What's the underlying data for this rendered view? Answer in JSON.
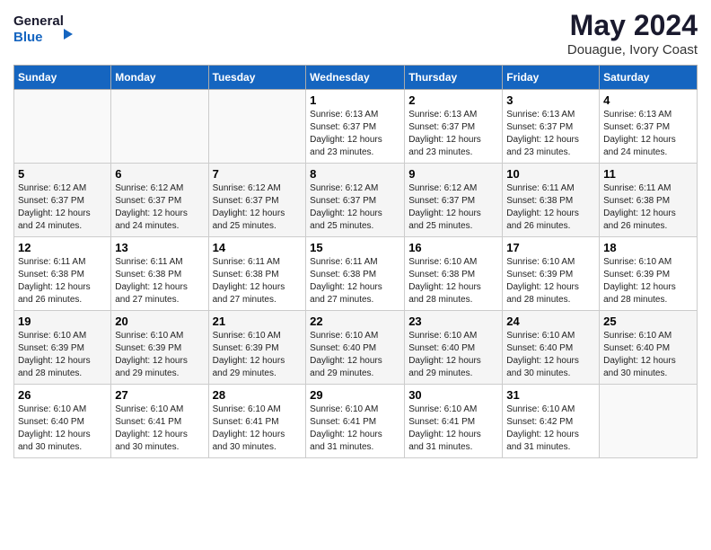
{
  "header": {
    "logo_line1": "General",
    "logo_line2": "Blue",
    "title": "May 2024",
    "subtitle": "Douague, Ivory Coast"
  },
  "weekdays": [
    "Sunday",
    "Monday",
    "Tuesday",
    "Wednesday",
    "Thursday",
    "Friday",
    "Saturday"
  ],
  "weeks": [
    [
      {
        "day": "",
        "info": ""
      },
      {
        "day": "",
        "info": ""
      },
      {
        "day": "",
        "info": ""
      },
      {
        "day": "1",
        "info": "Sunrise: 6:13 AM\nSunset: 6:37 PM\nDaylight: 12 hours\nand 23 minutes."
      },
      {
        "day": "2",
        "info": "Sunrise: 6:13 AM\nSunset: 6:37 PM\nDaylight: 12 hours\nand 23 minutes."
      },
      {
        "day": "3",
        "info": "Sunrise: 6:13 AM\nSunset: 6:37 PM\nDaylight: 12 hours\nand 23 minutes."
      },
      {
        "day": "4",
        "info": "Sunrise: 6:13 AM\nSunset: 6:37 PM\nDaylight: 12 hours\nand 24 minutes."
      }
    ],
    [
      {
        "day": "5",
        "info": "Sunrise: 6:12 AM\nSunset: 6:37 PM\nDaylight: 12 hours\nand 24 minutes."
      },
      {
        "day": "6",
        "info": "Sunrise: 6:12 AM\nSunset: 6:37 PM\nDaylight: 12 hours\nand 24 minutes."
      },
      {
        "day": "7",
        "info": "Sunrise: 6:12 AM\nSunset: 6:37 PM\nDaylight: 12 hours\nand 25 minutes."
      },
      {
        "day": "8",
        "info": "Sunrise: 6:12 AM\nSunset: 6:37 PM\nDaylight: 12 hours\nand 25 minutes."
      },
      {
        "day": "9",
        "info": "Sunrise: 6:12 AM\nSunset: 6:37 PM\nDaylight: 12 hours\nand 25 minutes."
      },
      {
        "day": "10",
        "info": "Sunrise: 6:11 AM\nSunset: 6:38 PM\nDaylight: 12 hours\nand 26 minutes."
      },
      {
        "day": "11",
        "info": "Sunrise: 6:11 AM\nSunset: 6:38 PM\nDaylight: 12 hours\nand 26 minutes."
      }
    ],
    [
      {
        "day": "12",
        "info": "Sunrise: 6:11 AM\nSunset: 6:38 PM\nDaylight: 12 hours\nand 26 minutes."
      },
      {
        "day": "13",
        "info": "Sunrise: 6:11 AM\nSunset: 6:38 PM\nDaylight: 12 hours\nand 27 minutes."
      },
      {
        "day": "14",
        "info": "Sunrise: 6:11 AM\nSunset: 6:38 PM\nDaylight: 12 hours\nand 27 minutes."
      },
      {
        "day": "15",
        "info": "Sunrise: 6:11 AM\nSunset: 6:38 PM\nDaylight: 12 hours\nand 27 minutes."
      },
      {
        "day": "16",
        "info": "Sunrise: 6:10 AM\nSunset: 6:38 PM\nDaylight: 12 hours\nand 28 minutes."
      },
      {
        "day": "17",
        "info": "Sunrise: 6:10 AM\nSunset: 6:39 PM\nDaylight: 12 hours\nand 28 minutes."
      },
      {
        "day": "18",
        "info": "Sunrise: 6:10 AM\nSunset: 6:39 PM\nDaylight: 12 hours\nand 28 minutes."
      }
    ],
    [
      {
        "day": "19",
        "info": "Sunrise: 6:10 AM\nSunset: 6:39 PM\nDaylight: 12 hours\nand 28 minutes."
      },
      {
        "day": "20",
        "info": "Sunrise: 6:10 AM\nSunset: 6:39 PM\nDaylight: 12 hours\nand 29 minutes."
      },
      {
        "day": "21",
        "info": "Sunrise: 6:10 AM\nSunset: 6:39 PM\nDaylight: 12 hours\nand 29 minutes."
      },
      {
        "day": "22",
        "info": "Sunrise: 6:10 AM\nSunset: 6:40 PM\nDaylight: 12 hours\nand 29 minutes."
      },
      {
        "day": "23",
        "info": "Sunrise: 6:10 AM\nSunset: 6:40 PM\nDaylight: 12 hours\nand 29 minutes."
      },
      {
        "day": "24",
        "info": "Sunrise: 6:10 AM\nSunset: 6:40 PM\nDaylight: 12 hours\nand 30 minutes."
      },
      {
        "day": "25",
        "info": "Sunrise: 6:10 AM\nSunset: 6:40 PM\nDaylight: 12 hours\nand 30 minutes."
      }
    ],
    [
      {
        "day": "26",
        "info": "Sunrise: 6:10 AM\nSunset: 6:40 PM\nDaylight: 12 hours\nand 30 minutes."
      },
      {
        "day": "27",
        "info": "Sunrise: 6:10 AM\nSunset: 6:41 PM\nDaylight: 12 hours\nand 30 minutes."
      },
      {
        "day": "28",
        "info": "Sunrise: 6:10 AM\nSunset: 6:41 PM\nDaylight: 12 hours\nand 30 minutes."
      },
      {
        "day": "29",
        "info": "Sunrise: 6:10 AM\nSunset: 6:41 PM\nDaylight: 12 hours\nand 31 minutes."
      },
      {
        "day": "30",
        "info": "Sunrise: 6:10 AM\nSunset: 6:41 PM\nDaylight: 12 hours\nand 31 minutes."
      },
      {
        "day": "31",
        "info": "Sunrise: 6:10 AM\nSunset: 6:42 PM\nDaylight: 12 hours\nand 31 minutes."
      },
      {
        "day": "",
        "info": ""
      }
    ]
  ]
}
